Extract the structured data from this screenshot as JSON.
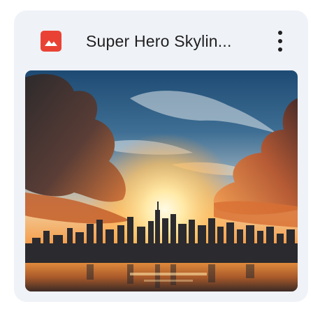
{
  "file_card": {
    "file_name": "Super Hero Skylin...",
    "file_type_icon": "image-file-icon",
    "more_icon": "more-vert-icon",
    "accent_color": "#e94235",
    "card_background": "#eff2f7"
  }
}
